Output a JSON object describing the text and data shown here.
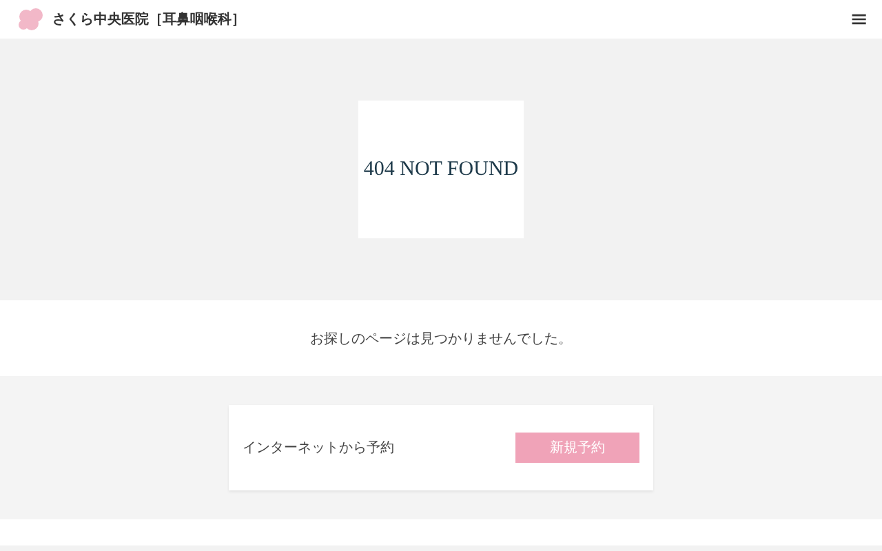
{
  "header": {
    "logo_text": "さくら中央医院［耳鼻咽喉科］",
    "menu_icon": "≡"
  },
  "hero": {
    "title": "404 NOT FOUND"
  },
  "message": "お探しのページは見つかりませんでした。",
  "reservation": {
    "label": "インターネットから予約",
    "button": "新規予約"
  }
}
